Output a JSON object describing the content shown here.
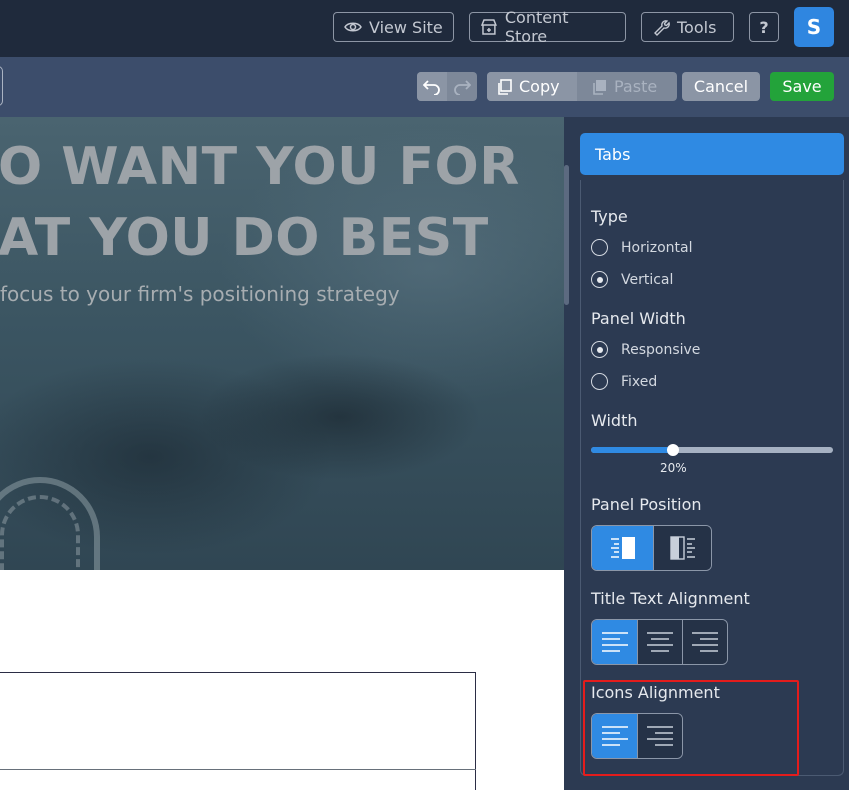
{
  "topbar": {
    "view_site": "View Site",
    "content_store": "Content Store",
    "tools": "Tools",
    "help": "?",
    "avatar_initial": "S"
  },
  "toolbar": {
    "copy": "Copy",
    "paste": "Paste",
    "cancel": "Cancel",
    "save": "Save"
  },
  "hero": {
    "line1": "O WANT YOU FOR",
    "line2": "AT YOU DO BEST",
    "subtitle": "focus to your firm's positioning strategy"
  },
  "panel": {
    "header": "Tabs",
    "type": {
      "label": "Type",
      "options": [
        "Horizontal",
        "Vertical"
      ],
      "selected": "Vertical"
    },
    "panel_width": {
      "label": "Panel Width",
      "options": [
        "Responsive",
        "Fixed"
      ],
      "selected": "Responsive"
    },
    "width": {
      "label": "Width",
      "value_label": "20%",
      "value_fraction": 0.34
    },
    "panel_position": {
      "label": "Panel Position",
      "options": [
        "left",
        "right"
      ],
      "selected": "left"
    },
    "title_text_alignment": {
      "label": "Title Text Alignment",
      "options": [
        "left",
        "center",
        "right"
      ],
      "selected": "left"
    },
    "icons_alignment": {
      "label": "Icons Alignment",
      "options": [
        "left",
        "right"
      ],
      "selected": "left"
    }
  },
  "colors": {
    "accent": "#2f8ae3",
    "save": "#23a33a",
    "highlight": "#e41c1c"
  }
}
